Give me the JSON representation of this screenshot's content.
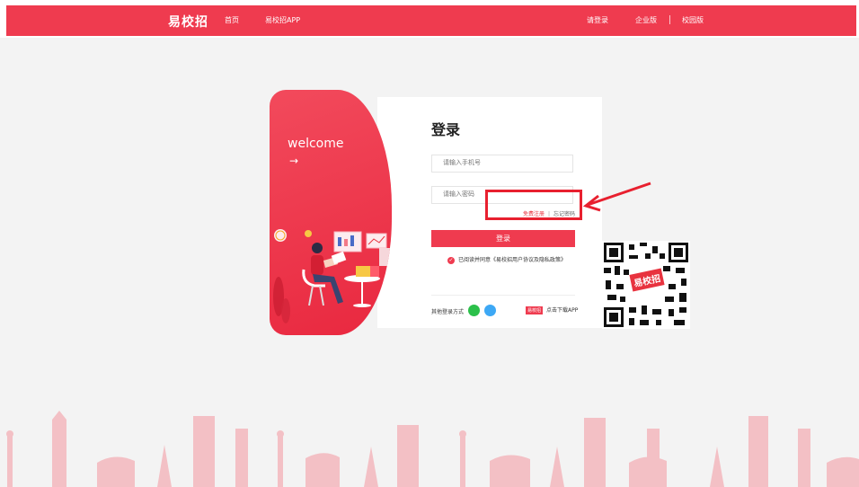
{
  "nav": {
    "logo": "易校招",
    "home": "首页",
    "app": "易校招APP",
    "login_prompt": "请登录",
    "enterprise": "企业版",
    "campus": "校园版"
  },
  "banner": {
    "welcome": "welcome",
    "arrow": "→"
  },
  "login": {
    "title": "登录",
    "phone_placeholder": "请输入手机号",
    "password_placeholder": "请输入密码",
    "register": "免费注册",
    "divider": "|",
    "forgot": "忘记密码",
    "submit": "登录",
    "agree_text": "已阅读并同意《易校招用户协议及隐私政策》",
    "other_login": "其他登录方式",
    "app_badge": "易校招",
    "download_app": "点击下载APP"
  },
  "qr_logo": "易校招",
  "colors": {
    "brand_red": "#ef3b4f",
    "highlight_red": "#e8202f",
    "wechat_green": "#2bc04a",
    "qq_blue": "#3da8f5"
  }
}
